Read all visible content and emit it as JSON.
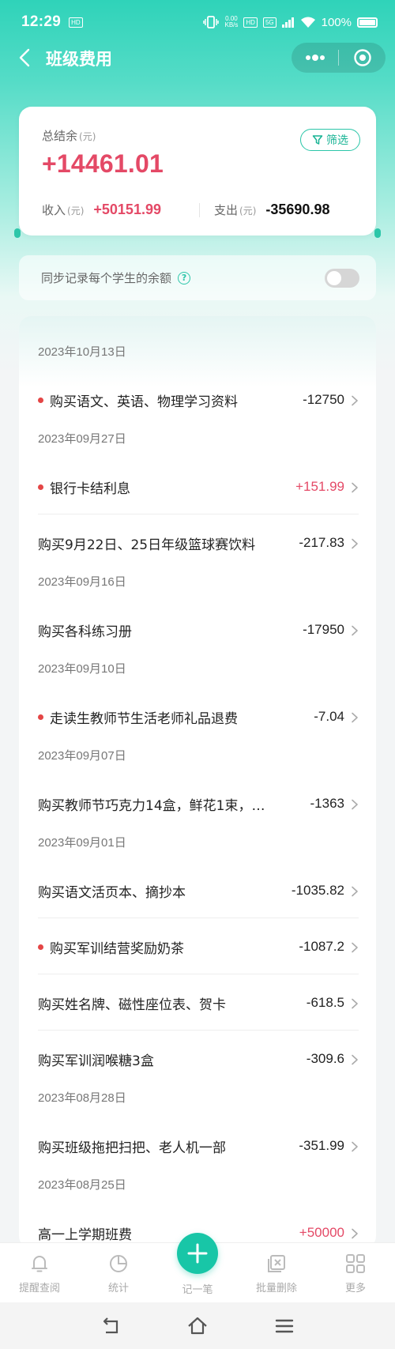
{
  "status_bar": {
    "time": "12:29",
    "hd_badge": "HD",
    "net_speed_value": "0.00",
    "net_speed_unit": "KB/s",
    "badge_hd": "HD",
    "badge_5g": "5G",
    "battery": "100%"
  },
  "nav": {
    "title": "班级费用"
  },
  "summary": {
    "total_label": "总结余",
    "unit": "(元)",
    "total_value": "+14461.01",
    "filter_label": "筛选",
    "income_label": "收入",
    "income_value": "+50151.99",
    "expense_label": "支出",
    "expense_value": "-35690.98"
  },
  "sync": {
    "label": "同步记录每个学生的余额",
    "enabled": false
  },
  "records": [
    {
      "type": "date",
      "text": "2023年10月13日"
    },
    {
      "type": "item",
      "text": "购买语文、英语、物理学习资料",
      "amount": "-12750",
      "dot": true
    },
    {
      "type": "date",
      "text": "2023年09月27日"
    },
    {
      "type": "item",
      "text": "银行卡结利息",
      "amount": "+151.99",
      "dot": true
    },
    {
      "type": "item",
      "text": "购买9月22日、25日年级篮球赛饮料",
      "amount": "-217.83",
      "dot": false
    },
    {
      "type": "date",
      "text": "2023年09月16日"
    },
    {
      "type": "item",
      "text": "购买各科练习册",
      "amount": "-17950",
      "dot": false
    },
    {
      "type": "date",
      "text": "2023年09月10日"
    },
    {
      "type": "item",
      "text": "走读生教师节生活老师礼品退费",
      "amount": "-7.04",
      "dot": true
    },
    {
      "type": "date",
      "text": "2023年09月07日"
    },
    {
      "type": "item",
      "text": "购买教师节巧克力14盒，鲜花1束，…",
      "amount": "-1363",
      "dot": false
    },
    {
      "type": "date",
      "text": "2023年09月01日"
    },
    {
      "type": "item",
      "text": "购买语文活页本、摘抄本",
      "amount": "-1035.82",
      "dot": false
    },
    {
      "type": "item",
      "text": "购买军训结营奖励奶茶",
      "amount": "-1087.2",
      "dot": true
    },
    {
      "type": "item",
      "text": "购买姓名牌、磁性座位表、贺卡",
      "amount": "-618.5",
      "dot": false
    },
    {
      "type": "item",
      "text": "购买军训润喉糖3盒",
      "amount": "-309.6",
      "dot": false
    },
    {
      "type": "date",
      "text": "2023年08月28日"
    },
    {
      "type": "item",
      "text": "购买班级拖把扫把、老人机一部",
      "amount": "-351.99",
      "dot": false
    },
    {
      "type": "date",
      "text": "2023年08月25日"
    },
    {
      "type": "item",
      "text": "高一上学期班费",
      "amount": "+50000",
      "dot": false
    }
  ],
  "tabbar": {
    "remind": "提醒查阅",
    "stats": "统计",
    "add": "记一笔",
    "batch_delete": "批量删除",
    "more": "更多"
  },
  "colors": {
    "accent": "#18c6a7",
    "positive": "#e44966",
    "dot": "#e44545"
  }
}
